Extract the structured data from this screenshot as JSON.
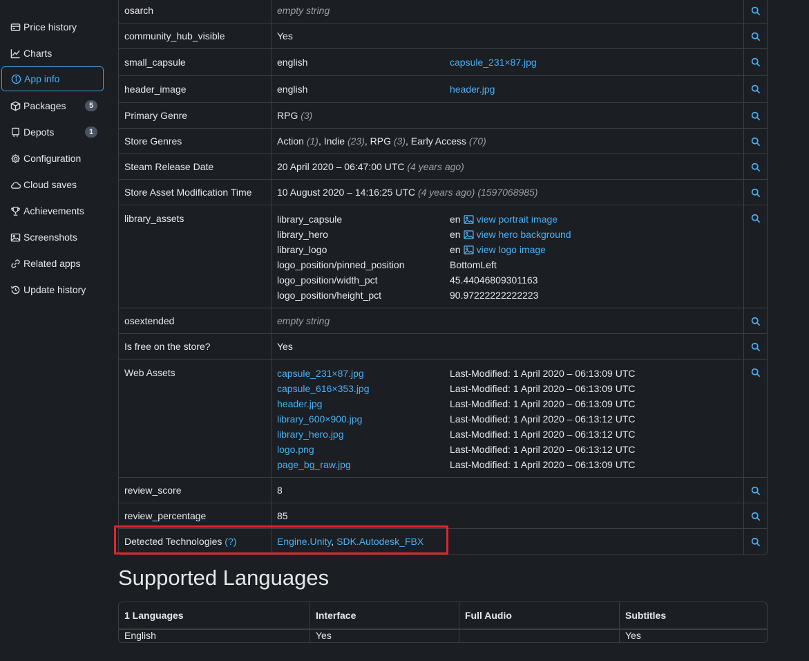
{
  "sidebar": {
    "items": [
      {
        "label": "Price history",
        "icon": "price-history-icon"
      },
      {
        "label": "Charts",
        "icon": "chart-icon"
      },
      {
        "label": "App info",
        "icon": "info-icon",
        "active": true
      },
      {
        "label": "Packages",
        "icon": "package-icon",
        "badge": "5"
      },
      {
        "label": "Depots",
        "icon": "depot-icon",
        "badge": "1"
      },
      {
        "label": "Configuration",
        "icon": "gear-icon"
      },
      {
        "label": "Cloud saves",
        "icon": "cloud-icon"
      },
      {
        "label": "Achievements",
        "icon": "trophy-icon"
      },
      {
        "label": "Screenshots",
        "icon": "image-icon"
      },
      {
        "label": "Related apps",
        "icon": "link-icon"
      },
      {
        "label": "Update history",
        "icon": "history-icon"
      }
    ]
  },
  "info": {
    "osarch": {
      "key": "osarch",
      "value": "empty string"
    },
    "community": {
      "key": "community_hub_visible",
      "value": "Yes"
    },
    "small_capsule": {
      "key": "small_capsule",
      "lang": "english",
      "file": "capsule_231×87.jpg"
    },
    "header_image": {
      "key": "header_image",
      "lang": "english",
      "file": "header.jpg"
    },
    "primary_genre": {
      "key": "Primary Genre",
      "name": "RPG",
      "id": "(3)"
    },
    "store_genres": {
      "key": "Store Genres",
      "items": [
        {
          "name": "Action",
          "id": "(1)",
          "sep": ","
        },
        {
          "name": "Indie",
          "id": "(23)",
          "sep": ","
        },
        {
          "name": "RPG",
          "id": "(3)",
          "sep": ","
        },
        {
          "name": "Early Access",
          "id": "(70)",
          "sep": ""
        }
      ]
    },
    "release_date": {
      "key": "Steam Release Date",
      "value": "20 April 2020 – 06:47:00 UTC",
      "ago": "(4 years ago)"
    },
    "asset_mod_time": {
      "key": "Store Asset Modification Time",
      "value": "10 August 2020 – 14:16:25 UTC",
      "ago": "(4 years ago)",
      "raw": "(1597068985)"
    },
    "library_assets": {
      "key": "library_assets",
      "capsule": {
        "name": "library_capsule",
        "lang": "en",
        "link": "view portrait image"
      },
      "hero": {
        "name": "library_hero",
        "lang": "en",
        "link": "view hero background"
      },
      "logo": {
        "name": "library_logo",
        "lang": "en",
        "link": "view logo image"
      },
      "pinned": {
        "name": "logo_position/pinned_position",
        "value": "BottomLeft"
      },
      "width": {
        "name": "logo_position/width_pct",
        "value": "45.44046809301163"
      },
      "height": {
        "name": "logo_position/height_pct",
        "value": "90.97222222222223"
      }
    },
    "osextended": {
      "key": "osextended",
      "value": "empty string"
    },
    "free": {
      "key": "Is free on the store?",
      "value": "Yes"
    },
    "web_assets": {
      "key": "Web Assets",
      "files": [
        {
          "file": "capsule_231×87.jpg",
          "modified": "Last-Modified: 1 April 2020 – 06:13:09 UTC"
        },
        {
          "file": "capsule_616×353.jpg",
          "modified": "Last-Modified: 1 April 2020 – 06:13:09 UTC"
        },
        {
          "file": "header.jpg",
          "modified": "Last-Modified: 1 April 2020 – 06:13:09 UTC"
        },
        {
          "file": "library_600×900.jpg",
          "modified": "Last-Modified: 1 April 2020 – 06:13:12 UTC"
        },
        {
          "file": "library_hero.jpg",
          "modified": "Last-Modified: 1 April 2020 – 06:13:12 UTC"
        },
        {
          "file": "logo.png",
          "modified": "Last-Modified: 1 April 2020 – 06:13:12 UTC"
        },
        {
          "file": "page_bg_raw.jpg",
          "modified": "Last-Modified: 1 April 2020 – 06:13:09 UTC"
        }
      ]
    },
    "review_score": {
      "key": "review_score",
      "value": "8"
    },
    "review_percentage": {
      "key": "review_percentage",
      "value": "85"
    },
    "detected_tech": {
      "key": "Detected Technologies",
      "help": "(?)",
      "tech1": "Engine.Unity",
      "sep": ",",
      "tech2": "SDK.Autodesk_FBX"
    }
  },
  "languages": {
    "title": "Supported Languages",
    "headers": [
      "1 Languages",
      "Interface",
      "Full Audio",
      "Subtitles"
    ],
    "rows": [
      [
        "English",
        "Yes",
        "",
        "Yes"
      ]
    ]
  },
  "colors": {
    "accent": "#4ab0f5",
    "highlight": "#e0252b",
    "background": "#1b1e23",
    "border": "#3a3f46"
  }
}
